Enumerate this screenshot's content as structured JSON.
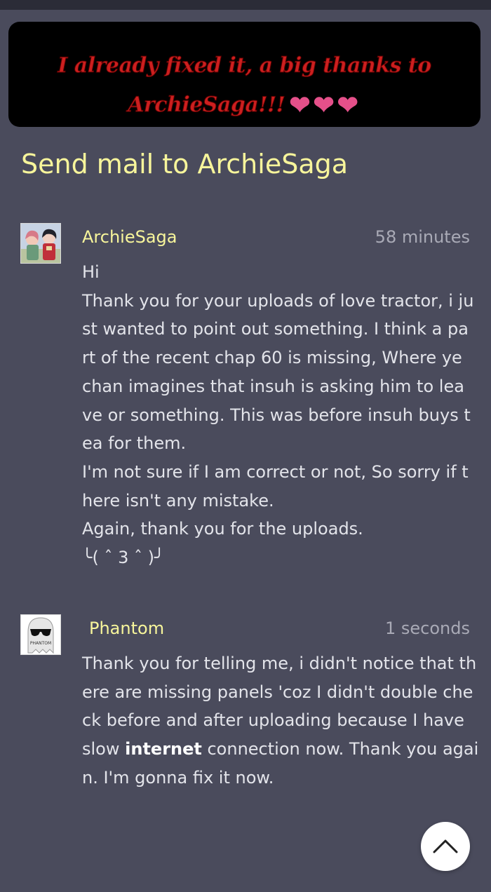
{
  "banner": {
    "line1": "I already fixed it, a big thanks to",
    "line2": "ArchieSaga!!!",
    "hearts": "❤❤❤",
    "text_color": "#cc1f1f",
    "heart_color": "#e5508a"
  },
  "heading": "Send mail to ArchieSaga",
  "messages": [
    {
      "author": "ArchieSaga",
      "time": "58 minutes",
      "avatar_icon": "anime-avatar-icon",
      "lines": [
        "Hi",
        "Thank you for your uploads of love tractor, i ju",
        "st wanted to point out something. I think a pa",
        "rt of the recent chap 60 is missing, Where ye",
        "chan imagines that insuh is asking him to lea",
        "ve or something. This was before insuh buys t",
        "ea for them.",
        "I'm not sure if I am correct or not, So sorry if t",
        "here isn't any mistake.",
        "Again, thank you for the uploads.",
        "╰( ˆ 3 ˆ )╯"
      ]
    },
    {
      "author": "Phantom",
      "time": "1 seconds",
      "avatar_icon": "ghost-sunglasses-icon",
      "avatar_text": "PHANTOM",
      "lines_before": [
        "Thank you for telling me, i didn't notice that th",
        "ere are missing panels 'coz I didn't double che",
        "ck before and after uploading because I have"
      ],
      "line4_pre": "slow ",
      "line4_kw": "internet",
      "line4_post": " connection now. Thank you agai",
      "line5": "n. I'm gonna fix it now."
    }
  ],
  "scroll_top_icon": "chevron-up-icon",
  "colors": {
    "background": "#4a4b5c",
    "accent_yellow": "#f7f59b",
    "body_text": "#e3e4ea",
    "muted_text": "#a9aab6"
  }
}
